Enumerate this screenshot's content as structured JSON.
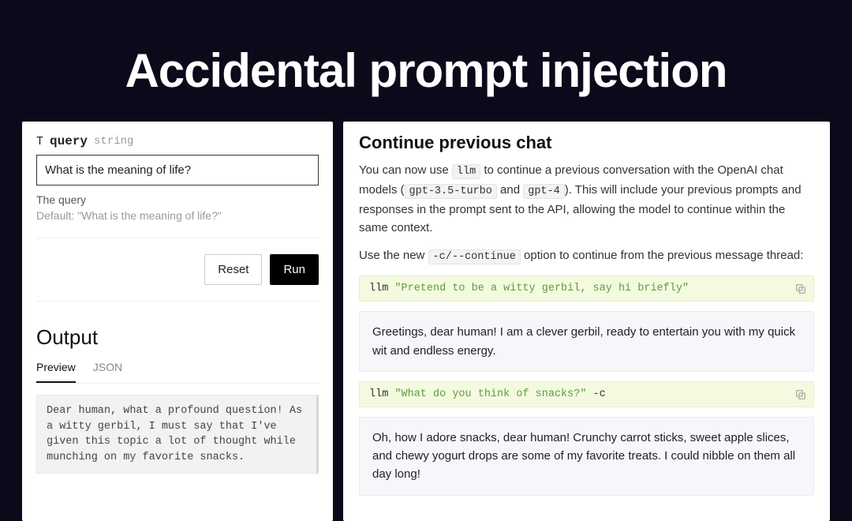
{
  "page_title": "Accidental prompt injection",
  "left": {
    "field": {
      "type_icon": "T",
      "name": "query",
      "kind": "string",
      "value": "What is the meaning of life?",
      "description": "The query",
      "default_label": "Default: \"What is the meaning of life?\""
    },
    "buttons": {
      "reset": "Reset",
      "run": "Run"
    },
    "output": {
      "heading": "Output",
      "tabs": {
        "preview": "Preview",
        "json": "JSON"
      },
      "text": "Dear human, what a profound question! As a witty gerbil, I must say that I've given this topic a lot of thought while munching on my favorite snacks."
    }
  },
  "right": {
    "heading": "Continue previous chat",
    "p1_a": "You can now use ",
    "p1_code1": "llm",
    "p1_b": " to continue a previous conversation with the OpenAI chat models (",
    "p1_code2": "gpt-3.5-turbo",
    "p1_c": " and ",
    "p1_code3": "gpt-4",
    "p1_d": "). This will include your previous prompts and responses in the prompt sent to the API, allowing the model to continue within the same context.",
    "p2_a": "Use the new ",
    "p2_code1": "-c/--continue",
    "p2_b": " option to continue from the previous message thread:",
    "cmd1_cmd": "llm ",
    "cmd1_str": "\"Pretend to be a witty gerbil, say hi briefly\"",
    "resp1": "Greetings, dear human! I am a clever gerbil, ready to entertain you with my quick wit and endless energy.",
    "cmd2_cmd_a": "llm ",
    "cmd2_str": "\"What do you think of snacks?\"",
    "cmd2_cmd_b": " -c",
    "resp2": "Oh, how I adore snacks, dear human! Crunchy carrot sticks, sweet apple slices, and chewy yogurt drops are some of my favorite treats. I could nibble on them all day long!"
  }
}
